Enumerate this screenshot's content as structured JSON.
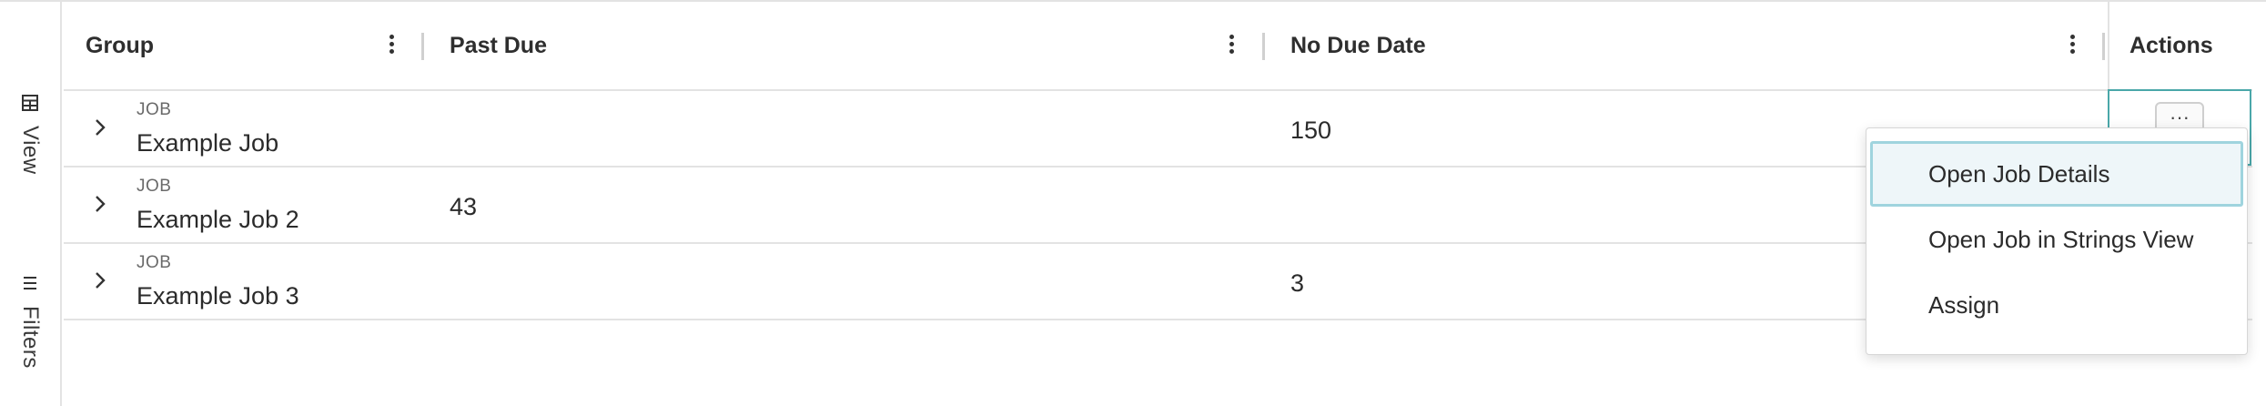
{
  "side_rail": {
    "view_label": "View",
    "filters_label": "Filters"
  },
  "table": {
    "columns": [
      {
        "label": "Group"
      },
      {
        "label": "Past Due"
      },
      {
        "label": "No Due Date"
      },
      {
        "label": "Actions"
      }
    ],
    "rows": [
      {
        "type": "JOB",
        "name": "Example Job",
        "past_due": "",
        "no_due_date": "150"
      },
      {
        "type": "JOB",
        "name": "Example Job 2",
        "past_due": "43",
        "no_due_date": ""
      },
      {
        "type": "JOB",
        "name": "Example Job 3",
        "past_due": "",
        "no_due_date": "3"
      }
    ],
    "more_button_label": "···"
  },
  "actions_menu": {
    "items": [
      {
        "label": "Open Job Details",
        "active": true
      },
      {
        "label": "Open Job in Strings View",
        "active": false
      },
      {
        "label": "Assign",
        "active": false
      }
    ]
  },
  "colors": {
    "accent": "#4aa7a9",
    "menu_highlight_bg": "#eef6f9",
    "menu_highlight_border": "#9fd4de",
    "divider": "#e3e3e3"
  }
}
